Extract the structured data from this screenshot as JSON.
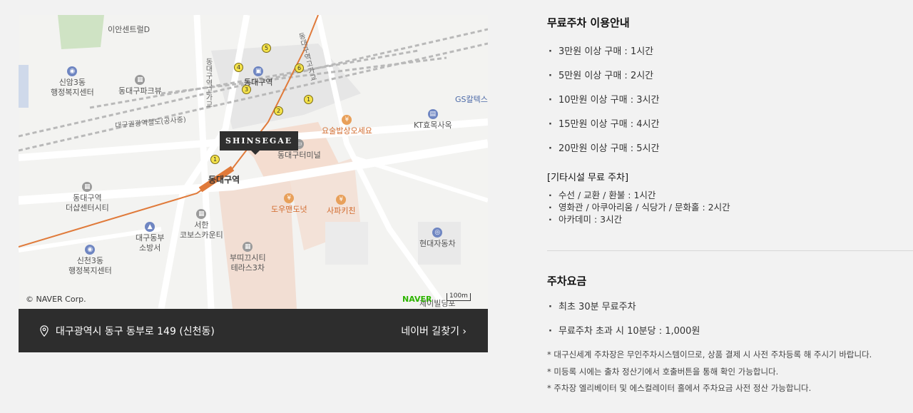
{
  "map": {
    "pois": {
      "ian_center": "이안센트럴D",
      "sinam3": "신암3동\n행정복지센터",
      "dongdaegu_park": "동대구파크뷰",
      "dongdaegu_station_top": "동대구역",
      "gs_caltex": "GS칼텍스",
      "kt": "KT효목사옥",
      "yosul": "요술밥상오세요",
      "terminal": "동대구터미널",
      "dongdaegu_station": "동대구역",
      "dongdaegu_health": "동대구역\n더샵센터시티",
      "dowoo": "도우맨도넛",
      "sapa": "사파키친",
      "seohan": "서한\n코보스카운티",
      "fire": "대구동부\n소방서",
      "hyundai": "현대자동차",
      "sincheon3": "신천3동\n행정복지센터",
      "buttikkeu": "부띠끄시티\n테라스3차",
      "railway": "대구권광역철도(공사중)",
      "bridge1": "동대구역고가교",
      "bridge2": "동대구역고가교",
      "bottom_right": "제이빌딩포"
    },
    "marker": "SHINSEGAE",
    "copyright": "© NAVER Corp.",
    "naver_logo": "NAVER",
    "scale": "100m",
    "exit_numbers": [
      "5",
      "4",
      "3",
      "6",
      "1",
      "2",
      "1"
    ]
  },
  "address_bar": {
    "address": "대구광역시 동구 동부로 149 (신천동)",
    "link": "네이버 길찾기 ›"
  },
  "free_parking": {
    "title": "무료주차 이용안내",
    "items": [
      "3만원 이상 구매 : 1시간",
      "5만원 이상 구매 : 2시간",
      "10만원 이상 구매 : 3시간",
      "15만원 이상 구매 : 4시간",
      "20만원 이상 구매 : 5시간"
    ],
    "other_title": "[기타시설 무료 주차]",
    "other_items": [
      "수선 / 교환 / 환불 : 1시간",
      "영화관 / 아쿠아리움 / 식당가 / 문화홀 : 2시간",
      "아카데미 : 3시간"
    ]
  },
  "parking_fee": {
    "title": "주차요금",
    "items": [
      "최초 30분 무료주차",
      "무료주차 초과 시 10분당 : 1,000원"
    ],
    "notes": [
      "* 대구신세계 주차장은 무인주차시스템이므로, 상품 결제 시 사전 주차등록 해 주시기 바랍니다.",
      "* 미등록 시에는 출차 정산기에서 호출버튼을 통해 확인 가능합니다.",
      "* 주차장 엘리베이터 및 에스컬레이터 홀에서 주차요금 사전 정산 가능합니다."
    ]
  }
}
